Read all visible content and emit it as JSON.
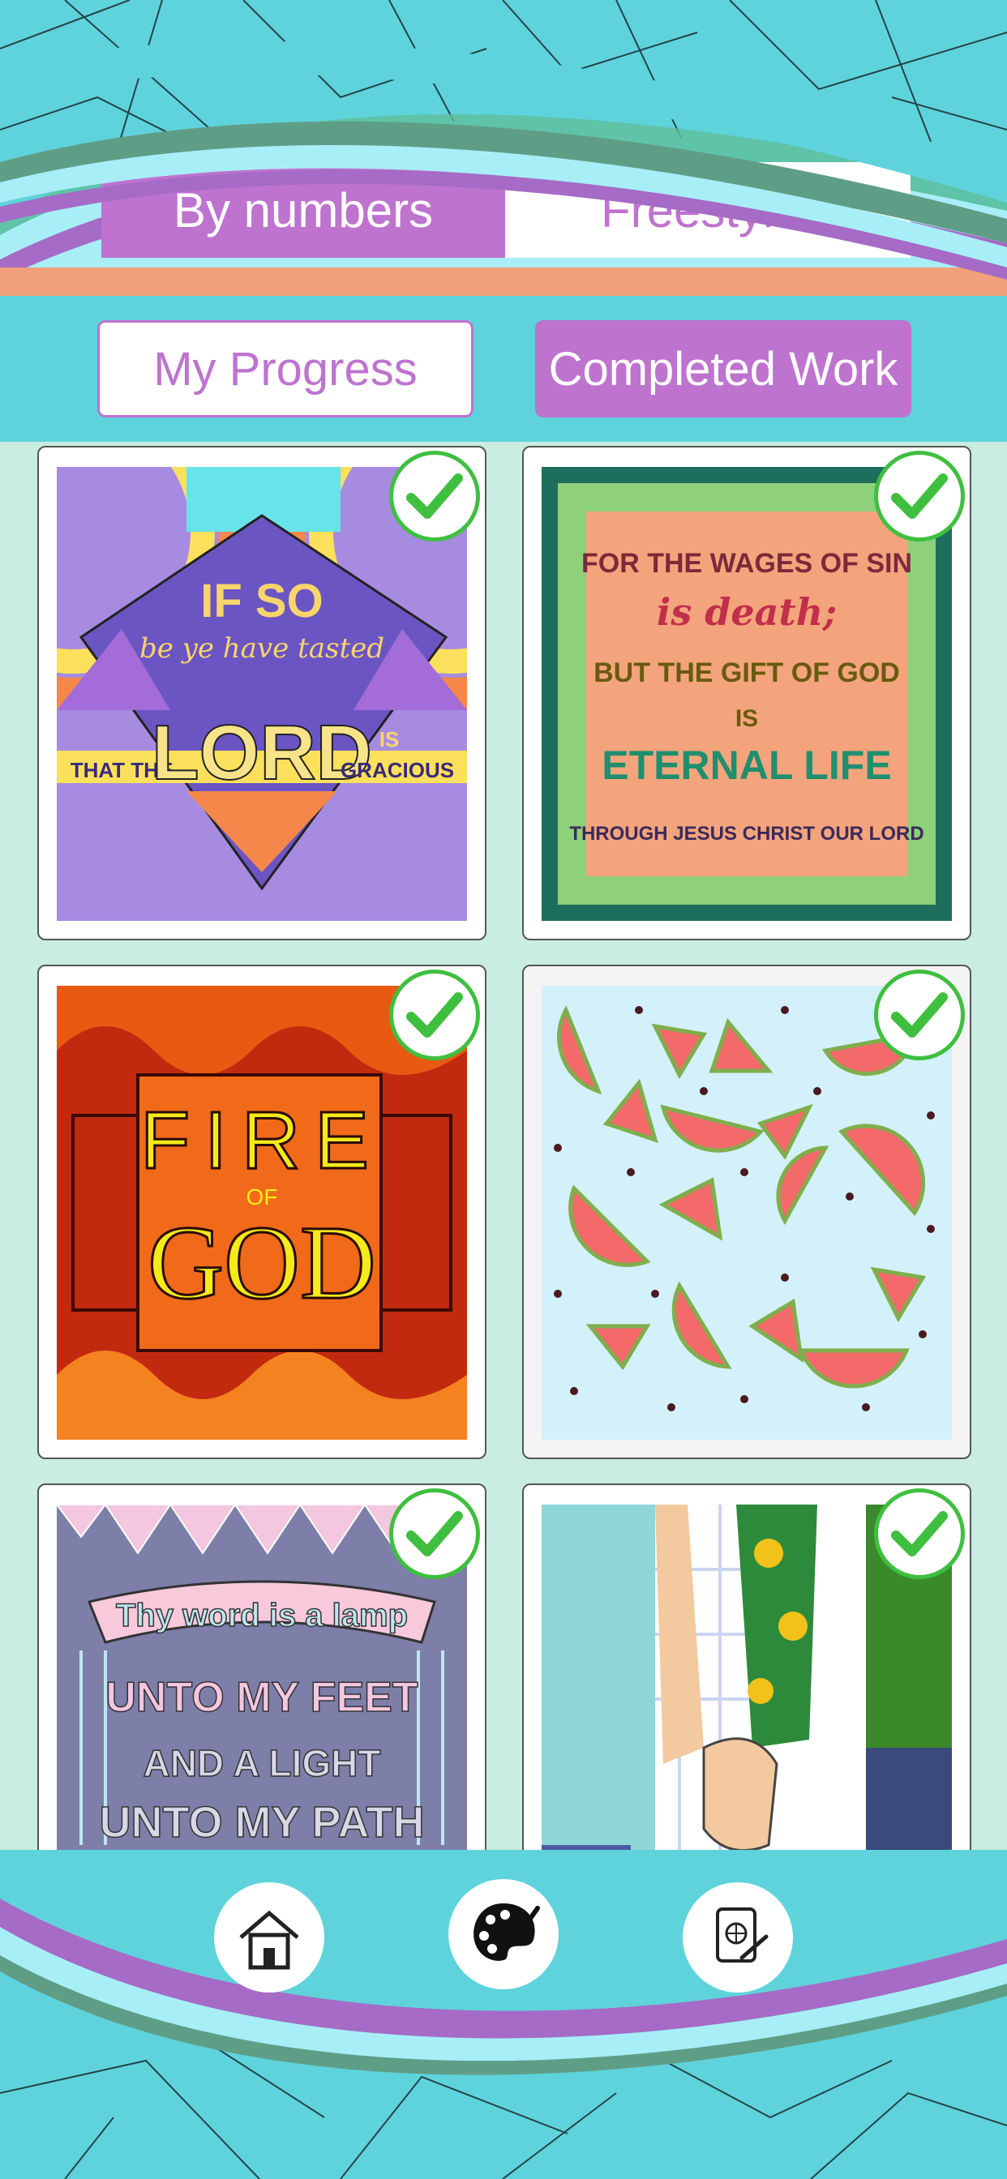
{
  "modes": {
    "by_numbers": "By numbers",
    "freestyle": "Freestyle"
  },
  "filters": {
    "progress": "My Progress",
    "completed": "Completed Work"
  },
  "colors": {
    "accent": "#be73cf",
    "teal": "#5fd3dc",
    "check": "#3fbf3f"
  },
  "artworks": [
    {
      "name": "If so be ye have tasted",
      "completed": true,
      "lines": [
        "IF SO",
        "be ye have tasted",
        "THAT THE",
        "LORD",
        "IS",
        "GRACIOUS"
      ]
    },
    {
      "name": "For the wages of sin",
      "completed": true,
      "lines": [
        "FOR THE WAGES OF SIN",
        "is death;",
        "BUT THE GIFT OF GOD",
        "IS",
        "ETERNAL LIFE",
        "THROUGH JESUS CHRIST OUR LORD"
      ]
    },
    {
      "name": "Fire of God",
      "completed": true,
      "lines": [
        "FIRE",
        "OF",
        "GOD"
      ]
    },
    {
      "name": "Watermelon",
      "completed": true,
      "lines": []
    },
    {
      "name": "Thy word is a lamp",
      "completed": true,
      "lines": [
        "Thy word is a lamp",
        "UNTO MY FEET",
        "AND A LIGHT",
        "UNTO MY PATH"
      ]
    },
    {
      "name": "Holding hands",
      "completed": true,
      "lines": []
    }
  ],
  "nav": [
    {
      "icon": "home-icon"
    },
    {
      "icon": "palette-icon"
    },
    {
      "icon": "gallery-icon"
    }
  ]
}
